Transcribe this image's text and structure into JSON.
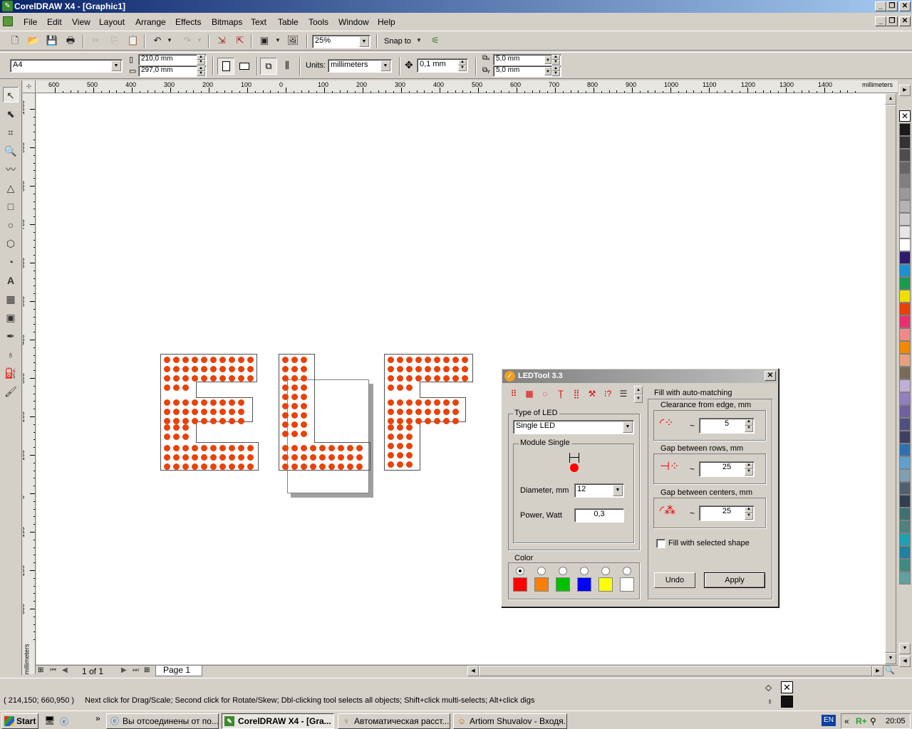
{
  "window": {
    "title": "CorelDRAW X4 - [Graphic1]"
  },
  "menu": [
    "File",
    "Edit",
    "View",
    "Layout",
    "Arrange",
    "Effects",
    "Bitmaps",
    "Text",
    "Table",
    "Tools",
    "Window",
    "Help"
  ],
  "toolbar": {
    "zoom": "25%",
    "snap_label": "Snap to"
  },
  "property_bar": {
    "paper": "A4",
    "width": "210,0 mm",
    "height": "297,0 mm",
    "units_label": "Units:",
    "units_value": "millimeters",
    "nudge": "0,1 mm",
    "dup_x": "5,0 mm",
    "dup_y": "5,0 mm"
  },
  "ruler": {
    "h_labels": [
      "600",
      "500",
      "400",
      "300",
      "200",
      "100",
      "0",
      "100",
      "200",
      "300",
      "400",
      "500",
      "600",
      "700",
      "800",
      "900",
      "1000",
      "1100",
      "1200",
      "1300",
      "1400"
    ],
    "h_unit": "millimeters",
    "v_labels": [
      "1000",
      "900",
      "800",
      "700",
      "600",
      "500",
      "400",
      "300",
      "200",
      "100",
      "0",
      "100",
      "200",
      "300"
    ],
    "v_unit": "millimeters"
  },
  "page_nav": {
    "count": "1 of 1",
    "tab": "Page 1"
  },
  "status": {
    "coords": "( 214,150; 660,950 )",
    "hint": "Next click for Drag/Scale; Second click for Rotate/Skew; Dbl-clicking tool selects all objects; Shift+click multi-selects; Alt+click digs"
  },
  "palette_colors": [
    "#1a1a1a",
    "#333333",
    "#4d4d4d",
    "#666666",
    "#808080",
    "#999999",
    "#b3b3b3",
    "#cccccc",
    "#e6e6e6",
    "#ffffff",
    "#2e1a6e",
    "#1e90d0",
    "#1a9a50",
    "#f0e000",
    "#e8400a",
    "#e83070",
    "#f08a8a",
    "#f08a00",
    "#e8a080",
    "#7a6a5a",
    "#c0b0d8",
    "#9080c0",
    "#7060a0",
    "#505080",
    "#404060",
    "#3070b0",
    "#60a0d0",
    "#80a0b0",
    "#506070",
    "#304050",
    "#407070",
    "#508080",
    "#20a0b0",
    "#2080a0",
    "#408a80",
    "#60a0a0"
  ],
  "dialog": {
    "title": "LEDTool 3.3",
    "type_of_led_label": "Type of LED",
    "type_of_led_value": "Single LED",
    "module_label": "Module Single",
    "diameter_label": "Diameter, mm",
    "diameter_value": "12",
    "power_label": "Power, Watt",
    "power_value": "0,3",
    "color_label": "Color",
    "colors": [
      "#ff0000",
      "#ff8000",
      "#00c000",
      "#0000ff",
      "#ffff00",
      "#ffffff"
    ],
    "fill_label": "Fill with auto-matching",
    "clearance_label": "Clearance from edge, mm",
    "clearance_value": "5",
    "gap_rows_label": "Gap between rows, mm",
    "gap_rows_value": "25",
    "gap_centers_label": "Gap between centers, mm",
    "gap_centers_value": "25",
    "fill_selected_label": "Fill with selected shape",
    "undo_label": "Undo",
    "apply_label": "Apply"
  },
  "taskbar": {
    "start": "Start",
    "tasks": [
      "Вы отсоединены от по...",
      "CorelDRAW X4 - [Gra...",
      "Автоматическая расст...",
      "Artiom Shuvalov - Входя..."
    ],
    "lang": "EN",
    "clock": "20:05"
  }
}
